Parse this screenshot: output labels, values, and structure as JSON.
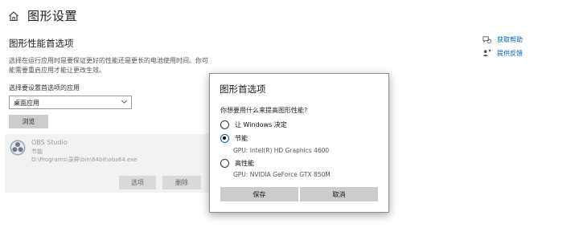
{
  "header": {
    "title": "图形设置"
  },
  "main": {
    "section_title": "图形性能首选项",
    "description": "选择在运行应用时是要保证更好的性能还是更长的电池使用时间。你可能需要重启应用才能让更改生效。",
    "select_label": "选择要设置首选项的应用",
    "dropdown_value": "桌面应用",
    "browse_label": "浏览"
  },
  "app_card": {
    "name": "OBS Studio",
    "mode": "节能",
    "path": "D:\\Programs\\录屏\\bin\\64bit\\obs64.exe",
    "options_label": "选项",
    "remove_label": "删除"
  },
  "side": {
    "help_label": "获取帮助",
    "feedback_label": "提供反馈"
  },
  "dialog": {
    "title": "图形首选项",
    "question": "你想要用什么来提高图形性能?",
    "options": [
      {
        "label": "让 Windows 决定",
        "gpu": "",
        "checked": false
      },
      {
        "label": "节能",
        "gpu": "GPU: Intel(R) HD Graphics 4600",
        "checked": true
      },
      {
        "label": "高性能",
        "gpu": "GPU: NVIDIA GeForce GTX 850M",
        "checked": false
      }
    ],
    "save_label": "保存",
    "cancel_label": "取消"
  },
  "colors": {
    "accent": "#0063b1",
    "button_gray": "#cccccc",
    "card_bg": "#f2f2f2"
  }
}
